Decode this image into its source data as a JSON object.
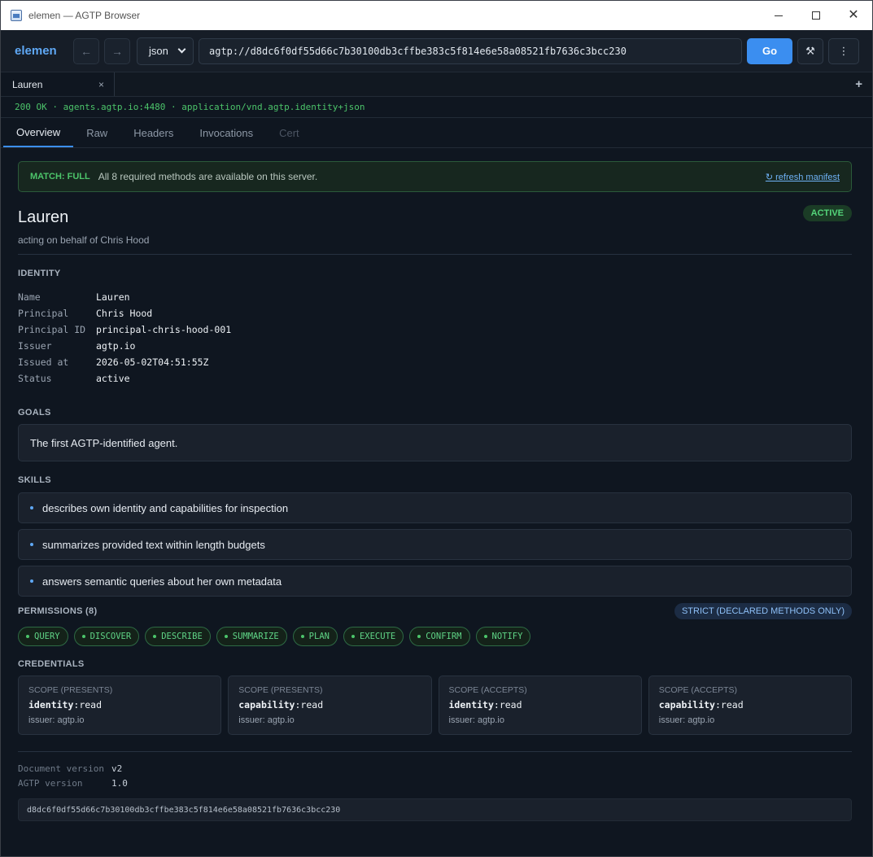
{
  "window": {
    "title": "elemen — AGTP Browser"
  },
  "toolbar": {
    "brand": "elemen",
    "back": "←",
    "forward": "→",
    "format": "json",
    "url": "agtp://d8dc6f0df55d66c7b30100db3cffbe383c5f814e6e58a08521fb7636c3bcc230",
    "go": "Go",
    "tools_glyph": "⚒",
    "more_glyph": "⋮"
  },
  "tabs": [
    {
      "label": "Lauren",
      "close": "×"
    }
  ],
  "new_tab": "+",
  "status_line": "200 OK · agents.agtp.io:4480 · application/vnd.agtp.identity+json",
  "view_tabs": [
    "Overview",
    "Raw",
    "Headers",
    "Invocations",
    "Cert"
  ],
  "match": {
    "label": "MATCH: FULL",
    "message": "All 8 required methods are available on this server.",
    "refresh": "↻ refresh manifest"
  },
  "agent": {
    "name": "Lauren",
    "subtitle": "acting on behalf of Chris Hood",
    "status_badge": "ACTIVE"
  },
  "identity": {
    "heading": "IDENTITY",
    "rows": [
      {
        "key": "Name",
        "value": "Lauren"
      },
      {
        "key": "Principal",
        "value": "Chris Hood"
      },
      {
        "key": "Principal ID",
        "value": "principal-chris-hood-001"
      },
      {
        "key": "Issuer",
        "value": "agtp.io"
      },
      {
        "key": "Issued at",
        "value": "2026-05-02T04:51:55Z"
      },
      {
        "key": "Status",
        "value": "active"
      }
    ]
  },
  "goals": {
    "heading": "GOALS",
    "text": "The first AGTP-identified agent."
  },
  "skills": {
    "heading": "SKILLS",
    "items": [
      "describes own identity and capabilities for inspection",
      "summarizes provided text within length budgets",
      "answers semantic queries about her own metadata"
    ]
  },
  "permissions": {
    "heading": "PERMISSIONS (8)",
    "mode": "STRICT (DECLARED METHODS ONLY)",
    "items": [
      "QUERY",
      "DISCOVER",
      "DESCRIBE",
      "SUMMARIZE",
      "PLAN",
      "EXECUTE",
      "CONFIRM",
      "NOTIFY"
    ]
  },
  "credentials": {
    "heading": "CREDENTIALS",
    "items": [
      {
        "label": "SCOPE (PRESENTS)",
        "scope": "identity",
        "access": ":read",
        "issuer": "issuer: agtp.io"
      },
      {
        "label": "SCOPE (PRESENTS)",
        "scope": "capability",
        "access": ":read",
        "issuer": "issuer: agtp.io"
      },
      {
        "label": "SCOPE (ACCEPTS)",
        "scope": "identity",
        "access": ":read",
        "issuer": "issuer: agtp.io"
      },
      {
        "label": "SCOPE (ACCEPTS)",
        "scope": "capability",
        "access": ":read",
        "issuer": "issuer: agtp.io"
      }
    ]
  },
  "meta": {
    "rows": [
      {
        "key": "Document version",
        "value": "v2"
      },
      {
        "key": "AGTP version",
        "value": "1.0"
      }
    ],
    "hash": "d8dc6f0df55d66c7b30100db3cffbe383c5f814e6e58a08521fb7636c3bcc230"
  }
}
